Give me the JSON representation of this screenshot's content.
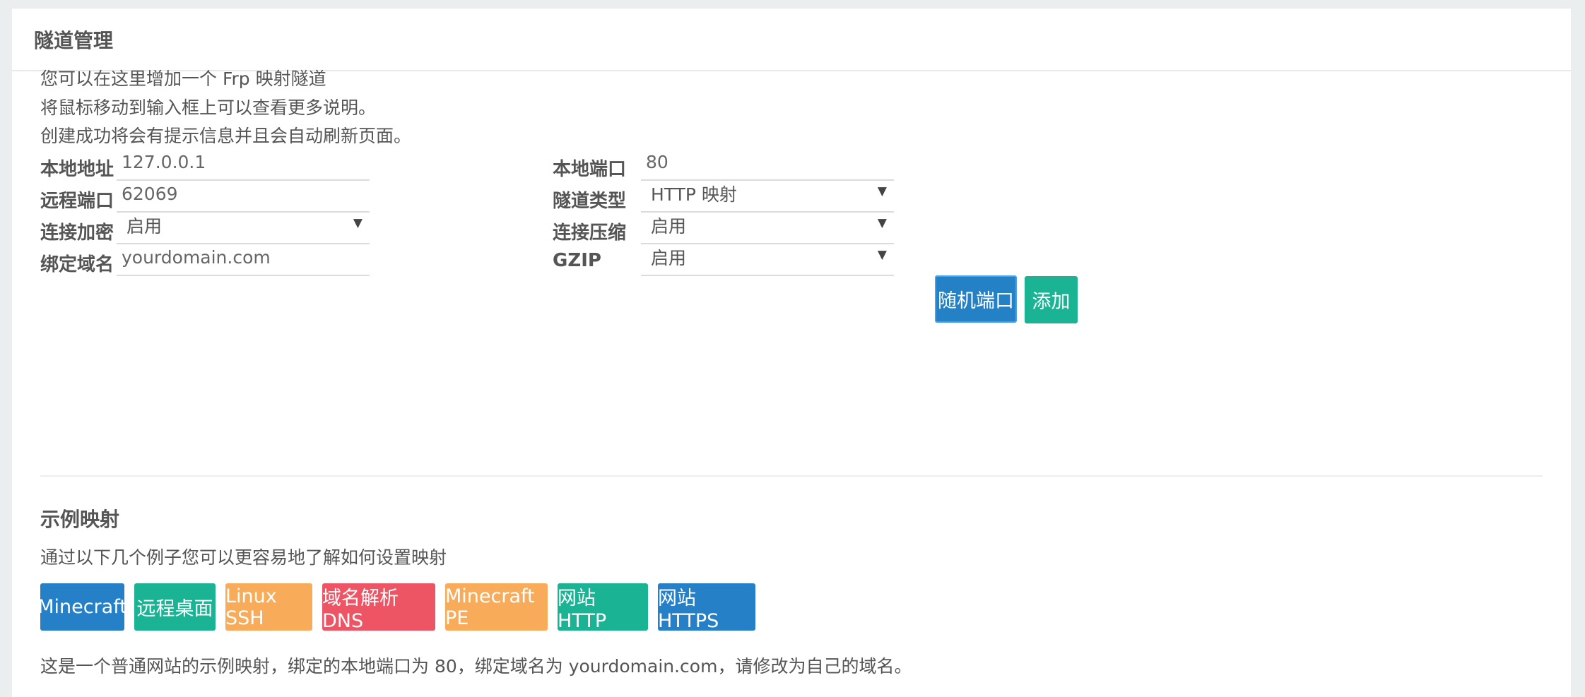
{
  "panel": {
    "title": "隧道管理",
    "intro": [
      "您可以在这里增加一个 Frp 映射隧道",
      "将鼠标移动到输入框上可以查看更多说明。",
      "创建成功将会有提示信息并且会自动刷新页面。"
    ]
  },
  "form": {
    "local_addr": {
      "label": "本地地址",
      "value": "127.0.0.1"
    },
    "local_port": {
      "label": "本地端口",
      "value": "80"
    },
    "remote_port": {
      "label": "远程端口",
      "value": "62069"
    },
    "tunnel_type": {
      "label": "隧道类型",
      "value": "HTTP 映射"
    },
    "encryption": {
      "label": "连接加密",
      "value": "启用"
    },
    "compression": {
      "label": "连接压缩",
      "value": "启用"
    },
    "domain": {
      "label": "绑定域名",
      "value": "yourdomain.com"
    },
    "gzip": {
      "label": "GZIP",
      "value": "启用"
    }
  },
  "actions": {
    "random_port": "随机端口",
    "add": "添加"
  },
  "examples": {
    "title": "示例映射",
    "desc": "通过以下几个例子您可以更容易地了解如何设置映射",
    "buttons": [
      "Minecraft",
      "远程桌面",
      "Linux SSH",
      "域名解析 DNS",
      "Minecraft PE",
      "网站 HTTP",
      "网站 HTTPS"
    ],
    "note": "这是一个普通网站的示例映射，绑定的本地端口为 80，绑定域名为 yourdomain.com，请修改为自己的域名。"
  },
  "colors": {
    "blue": "#2580c8",
    "green": "#1ab394",
    "orange": "#f8ac59",
    "red": "#ed5565"
  },
  "icons": {
    "select_caret": "caret-down-icon"
  }
}
